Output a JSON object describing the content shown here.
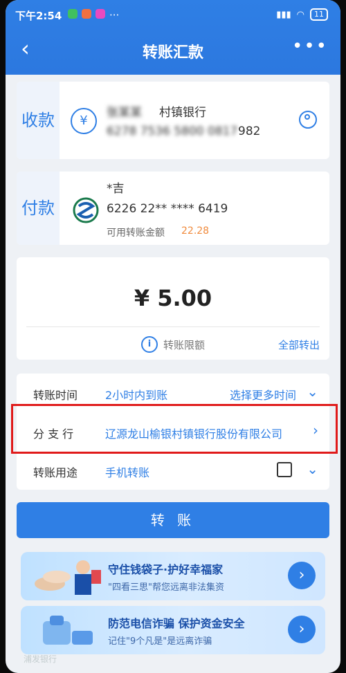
{
  "status": {
    "time": "下午2:54",
    "signal": "4G",
    "battery": "11"
  },
  "nav": {
    "title": "转账汇款",
    "back": "‹",
    "more": "•••"
  },
  "payee": {
    "tab": "收款",
    "name": "张某某",
    "bank": "村镇银行",
    "account_masked": "6278 7536 5800 0817",
    "account_tail": "982"
  },
  "payer": {
    "tab": "付款",
    "name": "*吉",
    "account": "6226 22** **** 6419",
    "balance_label": "可用转账金额",
    "balance": "22.28"
  },
  "amount": {
    "value": "¥ 5.00",
    "limit_label": "转账限额",
    "transfer_all": "全部转出"
  },
  "form": {
    "time_label": "转账时间",
    "time_value": "2小时内到账",
    "time_more": "选择更多时间",
    "branch_label": "分 支 行",
    "branch_value": "辽源龙山榆银村镇银行股份有限公司",
    "purpose_label": "转账用途",
    "purpose_value": "手机转账"
  },
  "submit_label": "转 账",
  "banners": [
    {
      "title": "守住钱袋子·护好幸福家",
      "sub": "\"四看三思\"帮您远离非法集资"
    },
    {
      "title": "防范电信诈骗 保护资金安全",
      "sub": "记住\"9个凡是\"是远离诈骗"
    }
  ],
  "bottom_hint": "浦发银行",
  "colors": {
    "accent": "#2f7fe5",
    "highlight": "#e01a1a",
    "balance": "#f08a3c"
  },
  "icons": {
    "payee": "yuan-icon",
    "payer": "spdb-logo",
    "person": "person-icon",
    "info": "info-icon",
    "edit": "edit-icon"
  }
}
